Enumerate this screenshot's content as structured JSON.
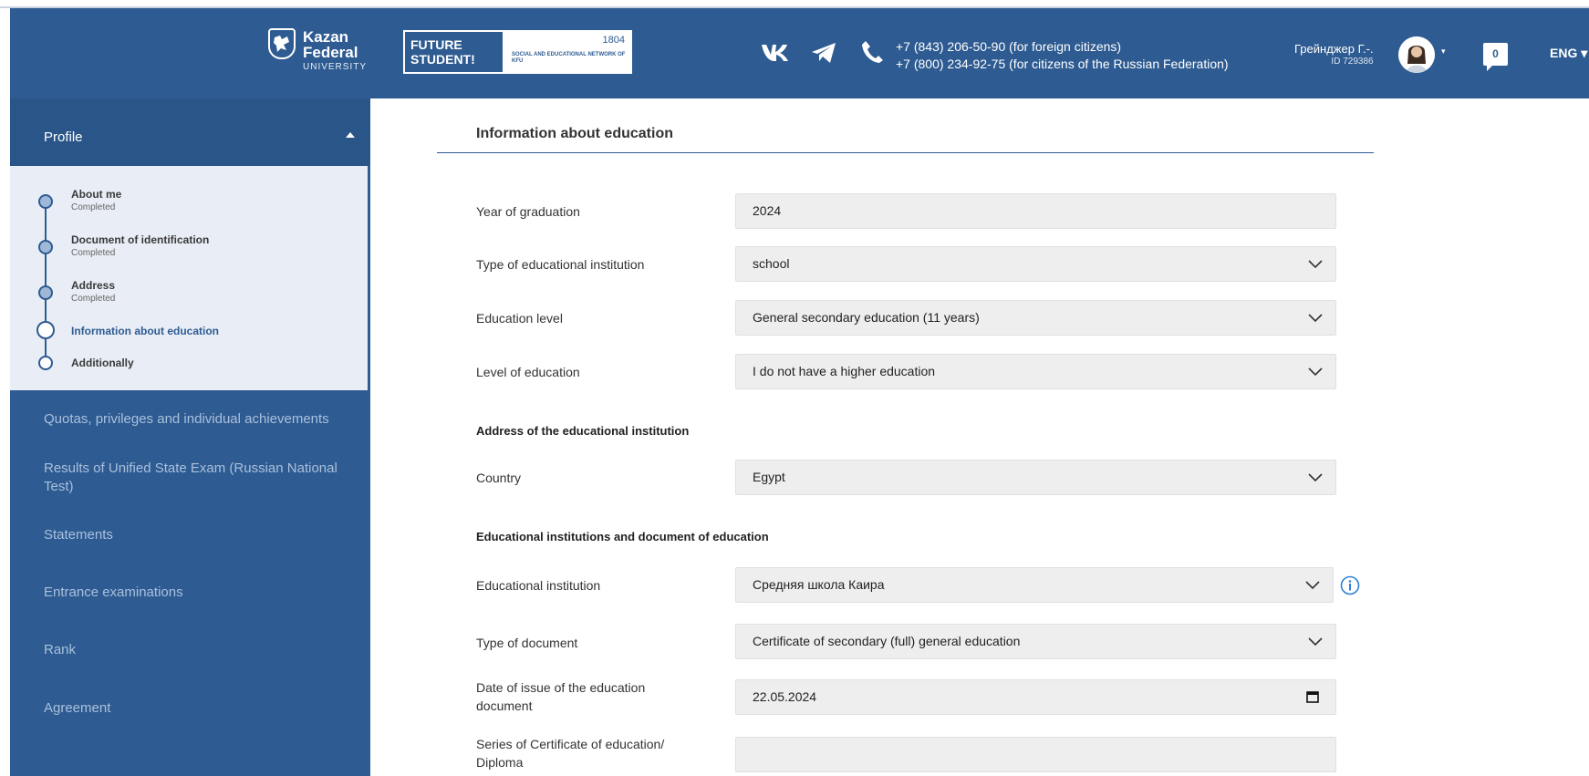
{
  "header": {
    "logo": {
      "line1": "Kazan",
      "line2": "Federal",
      "line3": "UNIVERSITY"
    },
    "future": {
      "title": "FUTURE\nSTUDENT!",
      "year": "1804",
      "network": "SOCIAL AND EDUCATIONAL NETWORK OF KFU"
    },
    "phones": [
      "+7 (843) 206-50-90 (for foreign citizens)",
      "+7 (800) 234-92-75 (for citizens of the Russian Federation)"
    ],
    "user": {
      "name": "Грейнджер Г.-.",
      "id": "ID 729386"
    },
    "notifications": "0",
    "language": "ENG"
  },
  "sidebar": {
    "profile_label": "Profile",
    "steps": [
      {
        "title": "About me",
        "status": "Completed"
      },
      {
        "title": "Document of identification",
        "status": "Completed"
      },
      {
        "title": "Address",
        "status": "Completed"
      },
      {
        "title": "Information about education",
        "status": ""
      },
      {
        "title": "Additionally",
        "status": ""
      }
    ],
    "nav": [
      "Quotas, privileges and individual achievements",
      "Results of Unified State Exam (Russian National Test)",
      "Statements",
      "Entrance examinations",
      "Rank",
      "Agreement"
    ]
  },
  "form": {
    "title": "Information about education",
    "subheads": {
      "address": "Address of the educational institution",
      "institutions": "Educational institutions and document of education"
    },
    "fields": {
      "year": {
        "label": "Year of graduation",
        "value": "2024"
      },
      "type": {
        "label": "Type of educational institution",
        "value": "school"
      },
      "edu_level": {
        "label": "Education level",
        "value": "General secondary education (11 years)"
      },
      "level": {
        "label": "Level of education",
        "value": "I do not have a higher education"
      },
      "country": {
        "label": "Country",
        "value": "Egypt"
      },
      "institution": {
        "label": "Educational institution",
        "value": "Средняя школа Каира"
      },
      "doc_type": {
        "label": "Type of document",
        "value": "Certificate of secondary (full) general education"
      },
      "issue_date": {
        "label": "Date of issue of the education document",
        "value": "22.05.2024"
      },
      "series": {
        "label": "Series of Certificate of education/ Diploma",
        "value": ""
      }
    }
  },
  "colors": {
    "primary": "#2e5b91",
    "sidebar_active_bg": "#e9eef6",
    "nav_text": "#a9c0dd",
    "field_bg": "#eeeeee"
  },
  "icons": [
    "vk-icon",
    "telegram-icon",
    "phone-icon",
    "chevron-down-icon",
    "calendar-icon",
    "info-icon"
  ]
}
